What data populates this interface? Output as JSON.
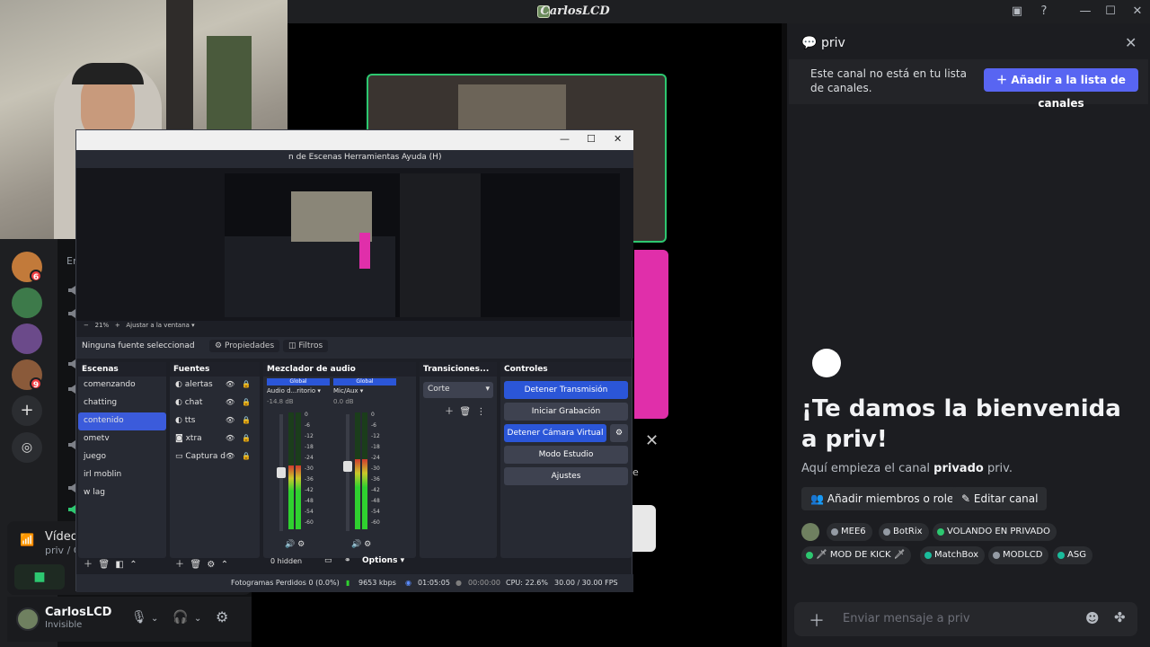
{
  "window": {
    "title": "CarlosLCD"
  },
  "servers": [
    {
      "name": "server-1",
      "badge": "6",
      "color": "#c27a3a"
    },
    {
      "name": "server-2",
      "badge": "",
      "color": "#3d7a4a"
    },
    {
      "name": "server-3",
      "badge": "",
      "color": "#6b4a8a"
    },
    {
      "name": "server-4",
      "badge": "9",
      "color": "#8a5a3a"
    }
  ],
  "rail_buttons": {
    "add": "+",
    "explore": "◎"
  },
  "channels": {
    "section_hint": "Er"
  },
  "voice": {
    "title": "Vídeo",
    "subtitle": "priv / C"
  },
  "user": {
    "name": "CarlosLCD",
    "status": "Invisible"
  },
  "stream": {
    "side_label": "e"
  },
  "obs": {
    "menu": [
      "n de Escenas",
      "Herramientas",
      "Ayuda (H)"
    ],
    "zoom": "21%",
    "zoom_option": "Ajustar a la ventana",
    "no_source": "Ninguna fuente seleccionad",
    "properties": "Propiedades",
    "filters": "Filtros",
    "panels": {
      "scenes": "Escenas",
      "sources": "Fuentes",
      "mixer": "Mezclador de audio",
      "transitions": "Transiciones...",
      "controls": "Controles"
    },
    "scenes": [
      "comenzando",
      "chatting",
      "contenido",
      "ometv",
      "juego",
      "irl moblin",
      "w lag"
    ],
    "selected_scene": "contenido",
    "sources": [
      "alertas",
      "chat",
      "tts",
      "xtra",
      "Captura d"
    ],
    "mixer": [
      {
        "tag": "Global",
        "name": "Audio d...ritorio",
        "db": "-14.8 dB",
        "level": 0.55
      },
      {
        "tag": "Global",
        "name": "Mic/Aux",
        "db": "0.0 dB",
        "level": 0.6
      }
    ],
    "meter_scale": [
      "0",
      "-6",
      "-12",
      "-18",
      "-24",
      "-30",
      "-36",
      "-42",
      "-48",
      "-54",
      "-60"
    ],
    "hidden": "0 hidden",
    "options": "Options",
    "transition": "Corte",
    "controls": [
      "Detener Transmisión",
      "Iniciar Grabación",
      "Detener Cámara Virtual",
      "Modo Estudio",
      "Ajustes"
    ],
    "status": {
      "dropped": "Fotogramas Perdidos 0 (0.0%)",
      "kbps": "9653 kbps",
      "stream_time": "01:05:05",
      "rec_time": "00:00:00",
      "cpu": "CPU: 22.6%",
      "fps": "30.00 / 30.00 FPS"
    }
  },
  "right": {
    "title": "priv",
    "notice": "Este canal no está en tu lista de canales.",
    "add_button": "Añadir a la lista de canales",
    "welcome_title": "¡Te damos la bienvenida a priv!",
    "welcome_desc_pre": "Aquí empieza el canal ",
    "welcome_desc_bold": "privado",
    "welcome_desc_post": " priv.",
    "add_members": "Añadir miembros o roles",
    "edit_channel": "Editar canal",
    "roles": [
      {
        "label": "MEE6",
        "color": "#949ba4"
      },
      {
        "label": "BotRix",
        "color": "#949ba4"
      },
      {
        "label": "VOLANDO EN PRIVADO",
        "color": "#2dc770"
      },
      {
        "label": "🗡 MOD DE KICK 🗡",
        "color": "#2dc770"
      },
      {
        "label": "MatchBox",
        "color": "#1abc9c"
      },
      {
        "label": "MODLCD",
        "color": "#949ba4"
      },
      {
        "label": "ASG",
        "color": "#1abc9c"
      }
    ],
    "message_placeholder": "Enviar mensaje a priv"
  }
}
